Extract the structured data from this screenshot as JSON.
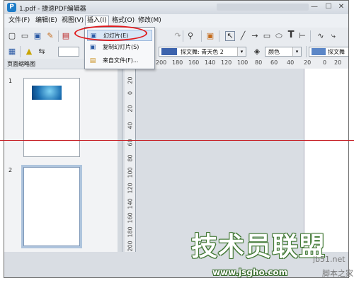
{
  "window": {
    "title": "1.pdf - 捷速PDF编辑器",
    "app_icon": "P",
    "min": "—",
    "max": "☐",
    "close": "✕"
  },
  "menu": [
    "文件(F)",
    "编辑(E)",
    "视图(V)",
    "插入(I)",
    "格式(O)",
    "修改(M)"
  ],
  "toolbar": {
    "font_name": "",
    "fill_label": "探文舞: 青天色 2",
    "color_label": "颜色",
    "fill2_label": "探文舞",
    "fill_color": "#3c63ad",
    "fill2_color": "#5b86c7"
  },
  "insert_menu": {
    "items": [
      {
        "label": "幻灯片(E)",
        "icon": "slide-icon"
      },
      {
        "label": "复制幻灯片(S)",
        "icon": "copy-slide-icon"
      },
      {
        "label": "来自文件(F)...",
        "icon": "file-icon"
      }
    ]
  },
  "sidebar": {
    "header": "页面缩略图",
    "thumbs": [
      {
        "num": "1"
      },
      {
        "num": "2"
      }
    ]
  },
  "ruler": {
    "h_ticks": [
      "200",
      "180",
      "160",
      "140",
      "120",
      "100",
      "80",
      "60",
      "40",
      "20",
      "0",
      "20"
    ],
    "v_ticks": [
      "20",
      "0",
      "20",
      "40",
      "60",
      "80",
      "100",
      "120",
      "140",
      "160",
      "180",
      "200"
    ]
  },
  "watermark": {
    "brand": "技术员联盟",
    "url": "www.jsgho.com",
    "side1": "jb51.net",
    "side2": "脚本之家"
  }
}
